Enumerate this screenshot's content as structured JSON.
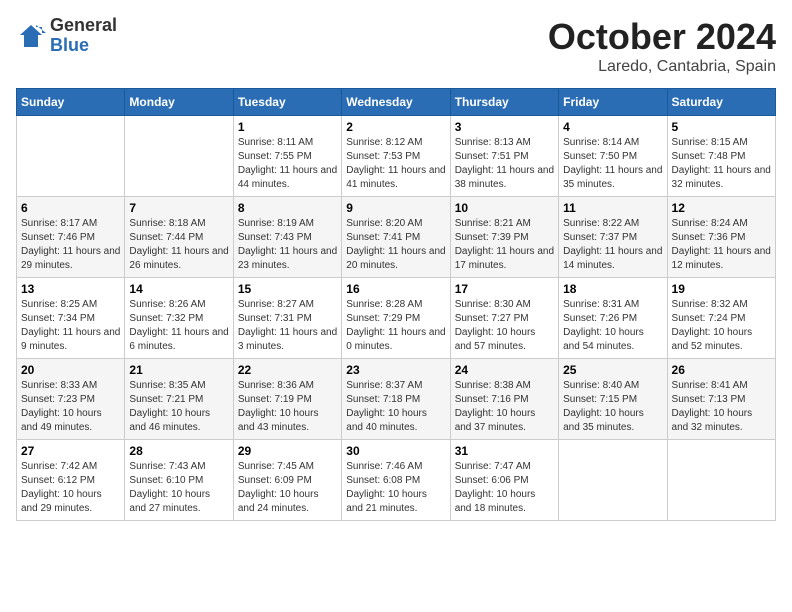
{
  "header": {
    "logo_general": "General",
    "logo_blue": "Blue",
    "title": "October 2024",
    "location": "Laredo, Cantabria, Spain"
  },
  "weekdays": [
    "Sunday",
    "Monday",
    "Tuesday",
    "Wednesday",
    "Thursday",
    "Friday",
    "Saturday"
  ],
  "weeks": [
    [
      {
        "day": "",
        "info": ""
      },
      {
        "day": "",
        "info": ""
      },
      {
        "day": "1",
        "info": "Sunrise: 8:11 AM\nSunset: 7:55 PM\nDaylight: 11 hours and 44 minutes."
      },
      {
        "day": "2",
        "info": "Sunrise: 8:12 AM\nSunset: 7:53 PM\nDaylight: 11 hours and 41 minutes."
      },
      {
        "day": "3",
        "info": "Sunrise: 8:13 AM\nSunset: 7:51 PM\nDaylight: 11 hours and 38 minutes."
      },
      {
        "day": "4",
        "info": "Sunrise: 8:14 AM\nSunset: 7:50 PM\nDaylight: 11 hours and 35 minutes."
      },
      {
        "day": "5",
        "info": "Sunrise: 8:15 AM\nSunset: 7:48 PM\nDaylight: 11 hours and 32 minutes."
      }
    ],
    [
      {
        "day": "6",
        "info": "Sunrise: 8:17 AM\nSunset: 7:46 PM\nDaylight: 11 hours and 29 minutes."
      },
      {
        "day": "7",
        "info": "Sunrise: 8:18 AM\nSunset: 7:44 PM\nDaylight: 11 hours and 26 minutes."
      },
      {
        "day": "8",
        "info": "Sunrise: 8:19 AM\nSunset: 7:43 PM\nDaylight: 11 hours and 23 minutes."
      },
      {
        "day": "9",
        "info": "Sunrise: 8:20 AM\nSunset: 7:41 PM\nDaylight: 11 hours and 20 minutes."
      },
      {
        "day": "10",
        "info": "Sunrise: 8:21 AM\nSunset: 7:39 PM\nDaylight: 11 hours and 17 minutes."
      },
      {
        "day": "11",
        "info": "Sunrise: 8:22 AM\nSunset: 7:37 PM\nDaylight: 11 hours and 14 minutes."
      },
      {
        "day": "12",
        "info": "Sunrise: 8:24 AM\nSunset: 7:36 PM\nDaylight: 11 hours and 12 minutes."
      }
    ],
    [
      {
        "day": "13",
        "info": "Sunrise: 8:25 AM\nSunset: 7:34 PM\nDaylight: 11 hours and 9 minutes."
      },
      {
        "day": "14",
        "info": "Sunrise: 8:26 AM\nSunset: 7:32 PM\nDaylight: 11 hours and 6 minutes."
      },
      {
        "day": "15",
        "info": "Sunrise: 8:27 AM\nSunset: 7:31 PM\nDaylight: 11 hours and 3 minutes."
      },
      {
        "day": "16",
        "info": "Sunrise: 8:28 AM\nSunset: 7:29 PM\nDaylight: 11 hours and 0 minutes."
      },
      {
        "day": "17",
        "info": "Sunrise: 8:30 AM\nSunset: 7:27 PM\nDaylight: 10 hours and 57 minutes."
      },
      {
        "day": "18",
        "info": "Sunrise: 8:31 AM\nSunset: 7:26 PM\nDaylight: 10 hours and 54 minutes."
      },
      {
        "day": "19",
        "info": "Sunrise: 8:32 AM\nSunset: 7:24 PM\nDaylight: 10 hours and 52 minutes."
      }
    ],
    [
      {
        "day": "20",
        "info": "Sunrise: 8:33 AM\nSunset: 7:23 PM\nDaylight: 10 hours and 49 minutes."
      },
      {
        "day": "21",
        "info": "Sunrise: 8:35 AM\nSunset: 7:21 PM\nDaylight: 10 hours and 46 minutes."
      },
      {
        "day": "22",
        "info": "Sunrise: 8:36 AM\nSunset: 7:19 PM\nDaylight: 10 hours and 43 minutes."
      },
      {
        "day": "23",
        "info": "Sunrise: 8:37 AM\nSunset: 7:18 PM\nDaylight: 10 hours and 40 minutes."
      },
      {
        "day": "24",
        "info": "Sunrise: 8:38 AM\nSunset: 7:16 PM\nDaylight: 10 hours and 37 minutes."
      },
      {
        "day": "25",
        "info": "Sunrise: 8:40 AM\nSunset: 7:15 PM\nDaylight: 10 hours and 35 minutes."
      },
      {
        "day": "26",
        "info": "Sunrise: 8:41 AM\nSunset: 7:13 PM\nDaylight: 10 hours and 32 minutes."
      }
    ],
    [
      {
        "day": "27",
        "info": "Sunrise: 7:42 AM\nSunset: 6:12 PM\nDaylight: 10 hours and 29 minutes."
      },
      {
        "day": "28",
        "info": "Sunrise: 7:43 AM\nSunset: 6:10 PM\nDaylight: 10 hours and 27 minutes."
      },
      {
        "day": "29",
        "info": "Sunrise: 7:45 AM\nSunset: 6:09 PM\nDaylight: 10 hours and 24 minutes."
      },
      {
        "day": "30",
        "info": "Sunrise: 7:46 AM\nSunset: 6:08 PM\nDaylight: 10 hours and 21 minutes."
      },
      {
        "day": "31",
        "info": "Sunrise: 7:47 AM\nSunset: 6:06 PM\nDaylight: 10 hours and 18 minutes."
      },
      {
        "day": "",
        "info": ""
      },
      {
        "day": "",
        "info": ""
      }
    ]
  ]
}
